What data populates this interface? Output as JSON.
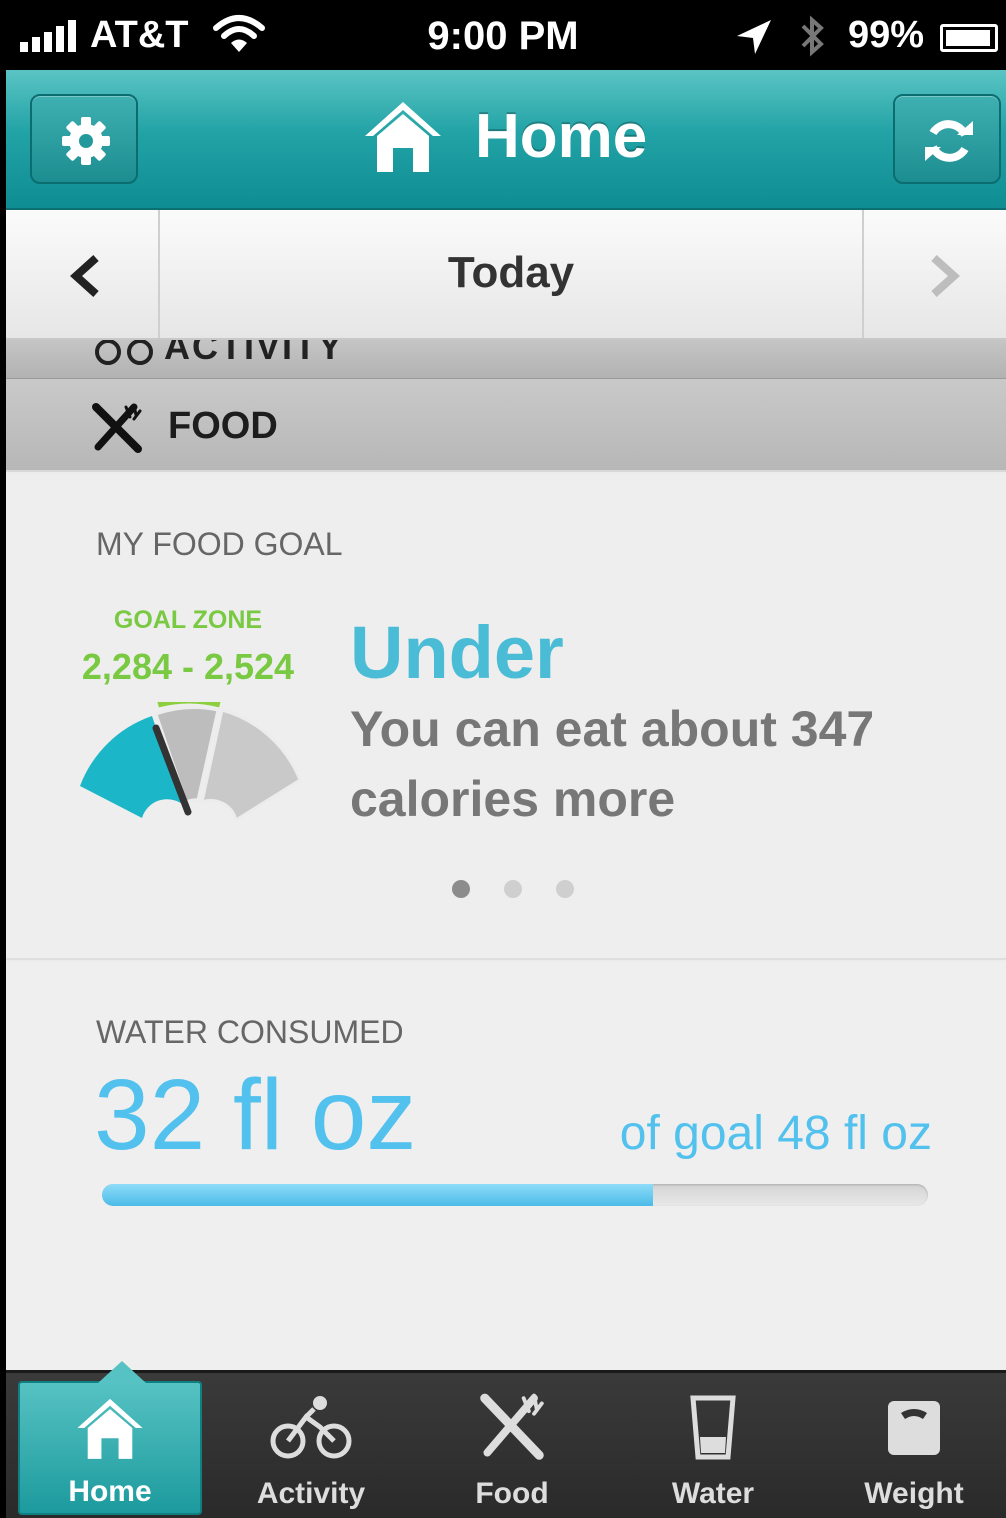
{
  "status_bar": {
    "carrier": "AT&T",
    "time": "9:00 PM",
    "battery": "99%"
  },
  "nav": {
    "title": "Home",
    "left_icon": "gear-icon",
    "right_icon": "sync-icon"
  },
  "date_nav": {
    "label": "Today"
  },
  "sections": {
    "peek_label": "ACTIVITY",
    "food_label": "FOOD"
  },
  "food_goal": {
    "title": "MY FOOD GOAL",
    "goal_zone_label": "GOAL ZONE",
    "goal_zone_range": "2,284 - 2,524",
    "status": "Under",
    "message": "You can eat about 347 calories more",
    "page_dots": 3,
    "active_dot": 0
  },
  "water": {
    "title": "WATER CONSUMED",
    "amount": "32 fl oz",
    "goal_text": "of goal 48 fl oz",
    "progress_fraction": 0.667
  },
  "tabs": [
    {
      "label": "Home",
      "icon": "home-icon",
      "active": true
    },
    {
      "label": "Activity",
      "icon": "bike-icon",
      "active": false
    },
    {
      "label": "Food",
      "icon": "fork-knife-icon",
      "active": false
    },
    {
      "label": "Water",
      "icon": "water-glass-icon",
      "active": false
    },
    {
      "label": "Weight",
      "icon": "scale-icon",
      "active": false
    }
  ],
  "colors": {
    "accent_teal": "#22a3a6",
    "goal_green": "#7ac943",
    "status_blue": "#4bbcd6",
    "water_blue": "#52c1ee"
  }
}
